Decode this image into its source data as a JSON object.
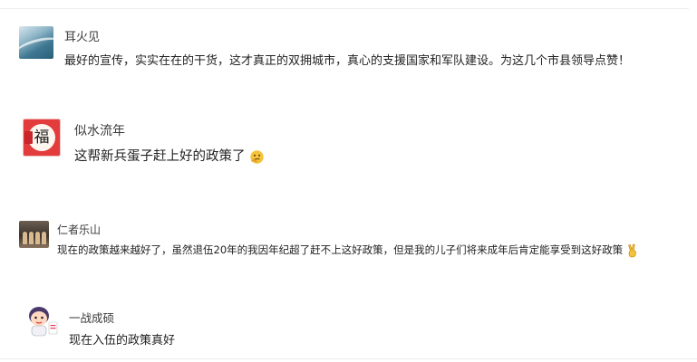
{
  "comments": [
    {
      "name": "耳火见",
      "text": "最好的宣传，实实在在的干货，这才真正的双拥城市，真心的支援国家和军队建设。为这几个市县领导点赞！",
      "avatar": "ocean-wave-avatar"
    },
    {
      "name": "似水流年",
      "text": "这帮新兵蛋子赶上好的政策了",
      "avatar_glyph": "福",
      "emoji": "thinking-face-icon"
    },
    {
      "name": "仁者乐山",
      "text": "现在的政策越来越好了，虽然退伍20年的我因年纪超了赶不上这好政策，但是我的儿子们将来成年后肯定能享受到这好政策",
      "avatar": "group-photo-avatar",
      "emoji": "victory-hand-icon"
    },
    {
      "name": "一战成硕",
      "text": "现在入伍的政策真好",
      "avatar": "cartoon-character-avatar"
    }
  ],
  "colors": {
    "text": "#222222",
    "name": "#3a3a3a",
    "divider": "#ededed",
    "avatar2_bg": "#e23c3c",
    "emoji_yellow": "#f5c33b"
  }
}
